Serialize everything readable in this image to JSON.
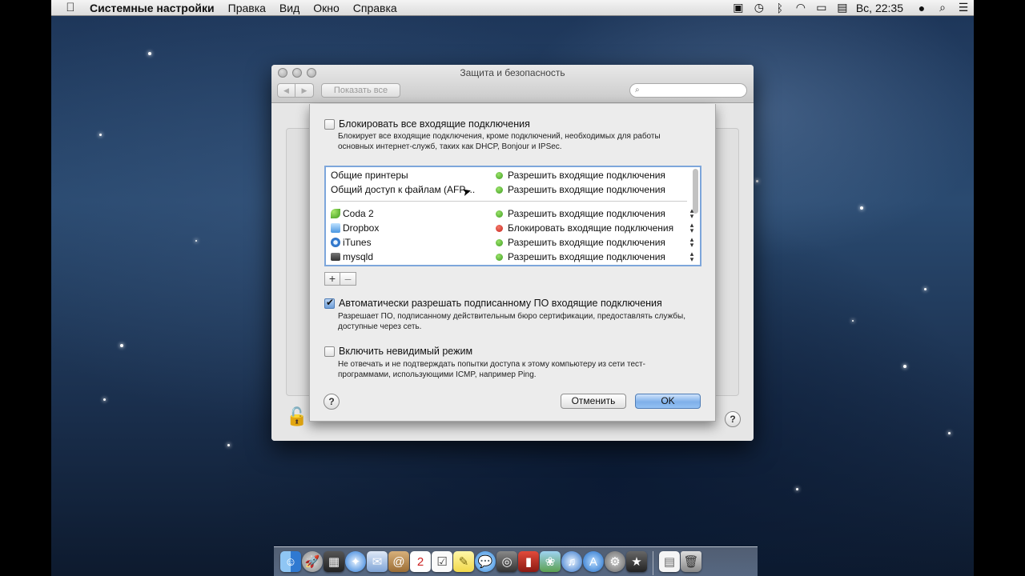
{
  "menubar": {
    "apple": "",
    "app_name": "Системные настройки",
    "items": [
      "Правка",
      "Вид",
      "Окно",
      "Справка"
    ],
    "clock": "Вс, 22:35"
  },
  "window": {
    "title": "Защита и безопасность",
    "show_all": "Показать все",
    "search_placeholder": ""
  },
  "sheet": {
    "block_all": {
      "label": "Блокировать все входящие подключения",
      "checked": false,
      "description": "Блокирует все входящие подключения, кроме подключений, необходимых для работы основных интернет-служб, таких как DHCP, Bonjour и IPSec."
    },
    "services": [
      {
        "name": "Общие принтеры",
        "status": "Разрешить входящие подключения",
        "color": "green"
      },
      {
        "name": "Общий доступ к файлам (AFP,...",
        "status": "Разрешить входящие подключения",
        "color": "green"
      }
    ],
    "apps": [
      {
        "name": "Coda 2",
        "icon": "coda-leaf-icon",
        "status": "Разрешить входящие подключения",
        "color": "green"
      },
      {
        "name": "Dropbox",
        "icon": "dropbox-box-icon",
        "status": "Блокировать входящие подключения",
        "color": "red"
      },
      {
        "name": "iTunes",
        "icon": "itunes-note-icon",
        "status": "Разрешить входящие подключения",
        "color": "green"
      },
      {
        "name": "mysqld",
        "icon": "terminal-icon",
        "status": "Разрешить входящие подключения",
        "color": "green"
      }
    ],
    "add_label": "+",
    "remove_label": "–",
    "auto_allow": {
      "label": "Автоматически разрешать подписанному ПО входящие подключения",
      "checked": true,
      "description": "Разрешает ПО, подписанному действительным бюро сертификации, предоставлять службы, доступные через сеть."
    },
    "stealth": {
      "label": "Включить невидимый режим",
      "checked": false,
      "description": "Не отвечать и не подтверждать попытки доступа к этому компьютеру из сети тест-программами, использующими ICMP, например Ping."
    },
    "help_label": "?",
    "cancel_label": "Отменить",
    "ok_label": "OK"
  },
  "colors": {
    "green": "#3d9c21",
    "red": "#c4221a",
    "focus": "#7da6db"
  }
}
